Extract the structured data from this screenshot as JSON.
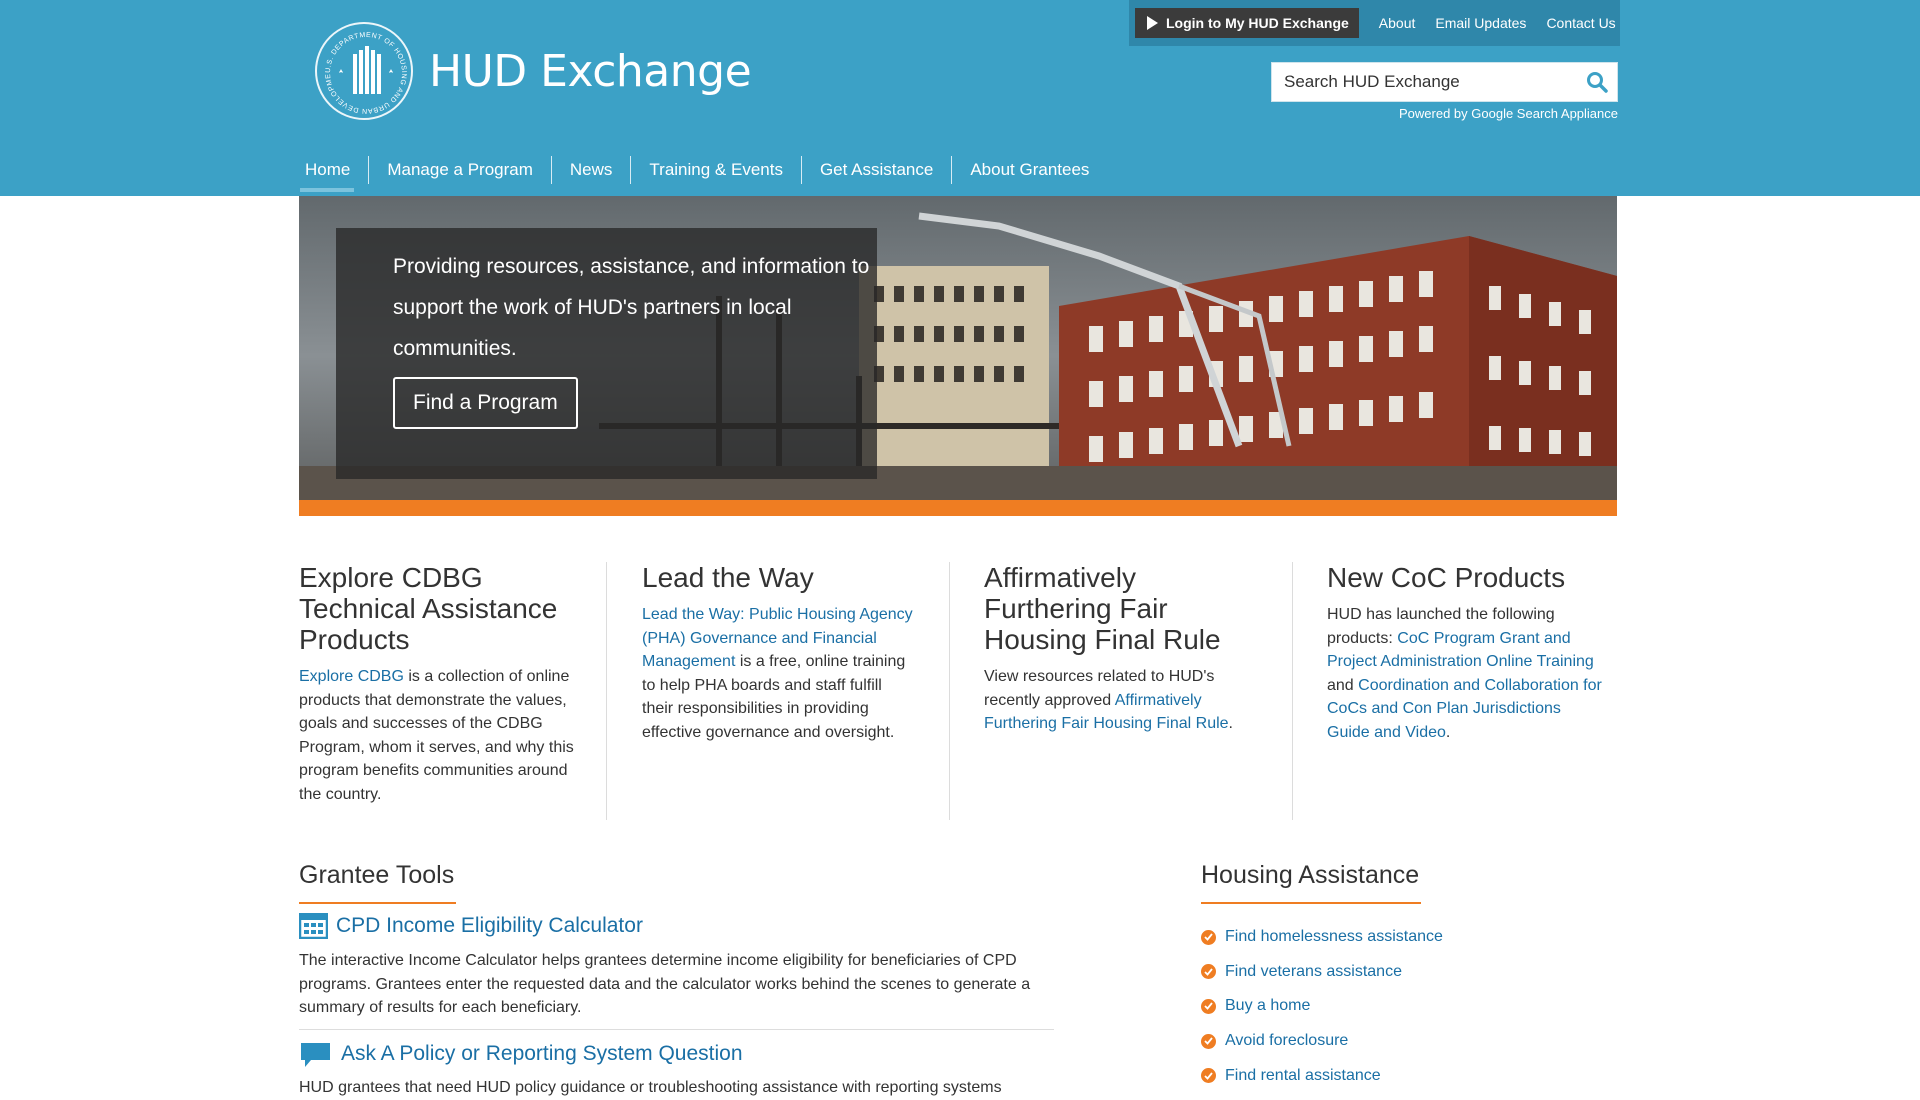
{
  "header": {
    "brand": "HUD Exchange",
    "seal_text": "U.S. DEPARTMENT OF HOUSING AND URBAN DEVELOPMENT",
    "utility": {
      "login": "Login to My HUD Exchange",
      "links": [
        "About",
        "Email Updates",
        "Contact Us"
      ]
    },
    "search": {
      "placeholder": "Search HUD Exchange",
      "powered_by": "Powered by Google Search Appliance"
    },
    "nav": [
      "Home",
      "Manage a Program",
      "News",
      "Training & Events",
      "Get Assistance",
      "About Grantees"
    ],
    "active_nav": "Home",
    "colors": {
      "header_bg": "#3ca1c6",
      "accent": "#ef7d22",
      "link": "#1a6fa5"
    }
  },
  "hero": {
    "text": "Providing resources, assistance, and information to support the work of HUD's partners in local communities.",
    "button": "Find a Program"
  },
  "features": [
    {
      "title": "Explore CDBG Technical Assistance Products",
      "link": "Explore CDBG",
      "body": " is a collection of online products that demonstrate the values, goals and successes of the CDBG Program, whom it serves, and why this program benefits communities around the country."
    },
    {
      "title": "Lead the Way",
      "link": "Lead the Way: Public Housing Agency (PHA) Governance and Financial Management",
      "body": " is a free, online training to help PHA boards and staff fulfill their responsibilities in providing effective governance and oversight."
    },
    {
      "title": "Affirmatively Furthering Fair Housing Final Rule",
      "pre": "View resources related to HUD's recently approved ",
      "link": "Affirmatively Furthering Fair Housing Final Rule",
      "post": "."
    },
    {
      "title": "New CoC Products",
      "pre": "HUD has launched the following products: ",
      "link1": "CoC Program Grant and Project Administration Online Training",
      "mid": " and ",
      "link2": "Coordination and Collaboration for CoCs and Con Plan Jurisdictions Guide and Video",
      "post": "."
    }
  ],
  "grantee_tools": {
    "title": "Grantee Tools",
    "items": [
      {
        "title": "CPD Income Eligibility Calculator",
        "icon": "calculator-icon",
        "desc": "The interactive Income Calculator helps grantees determine income eligibility for beneficiaries of CPD programs. Grantees enter the requested data and the calculator works behind the scenes to generate a summary of results for each beneficiary."
      },
      {
        "title": "Ask A Policy or Reporting System Question",
        "icon": "speech-bubble-icon",
        "desc": "HUD grantees that need HUD policy guidance or troubleshooting assistance with reporting systems"
      }
    ]
  },
  "housing_assistance": {
    "title": "Housing Assistance",
    "items": [
      "Find homelessness assistance",
      "Find veterans assistance",
      "Buy a home",
      "Avoid foreclosure",
      "Find rental assistance"
    ]
  }
}
